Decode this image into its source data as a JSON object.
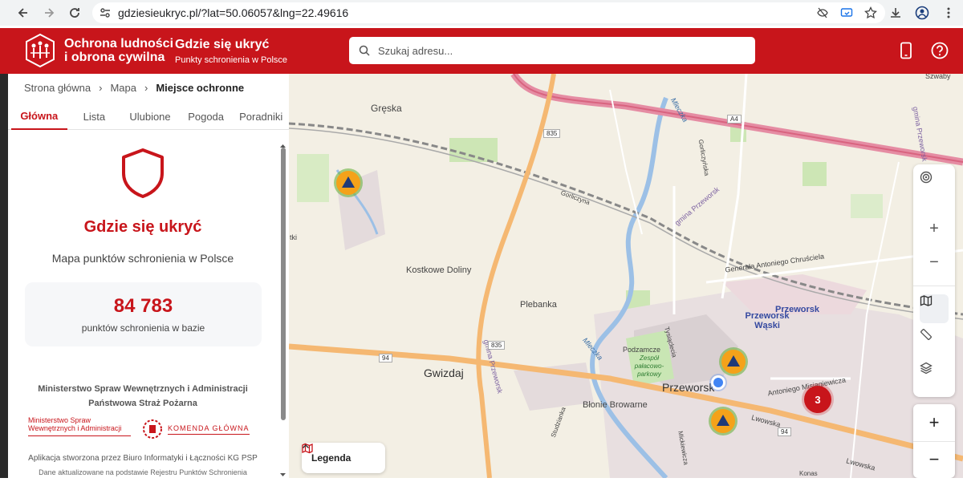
{
  "browser": {
    "url": "gdziesieukryc.pl/?lat=50.06057&lng=22.49616"
  },
  "header": {
    "brand_line1": "Ochrona ludności",
    "brand_line2": "i obrona cywilna",
    "app_title": "Gdzie się ukryć",
    "app_subtitle": "Punkty schronienia w Polsce",
    "search_placeholder": "Szukaj adresu...",
    "accent_color": "#c8151b"
  },
  "sidebar": {
    "breadcrumb": [
      "Strona główna",
      "Mapa",
      "Miejsce ochronne"
    ],
    "tabs": [
      {
        "label": "Główna",
        "active": true
      },
      {
        "label": "Lista",
        "active": false
      },
      {
        "label": "Ulubione",
        "active": false
      },
      {
        "label": "Pogoda",
        "active": false
      },
      {
        "label": "Poradniki",
        "active": false
      }
    ],
    "title": "Gdzie się ukryć",
    "subtitle": "Mapa punktów schronienia w Polsce",
    "stat_value": "84 783",
    "stat_label": "punktów schronienia w bazie",
    "ministry_line1": "Ministerstwo Spraw Wewnętrznych i Administracji",
    "ministry_line2": "Państwowa Straż Pożarna",
    "logo_mswia_line1": "Ministerstwo Spraw",
    "logo_mswia_line2": "Wewnętrznych i Administracji",
    "logo_kgp": "KOMENDA GŁÓWNA",
    "footer_line1": "Aplikacja stworzona przez Biuro Informatyki i Łączności KG PSP",
    "footer_line2": "Dane aktualizowane na podstawie Rejestru Punktów Schronienia"
  },
  "map": {
    "labels": {
      "grzeska": "Gręska",
      "kostkowe": "Kostkowe Doliny",
      "plebanka": "Plebanka",
      "gwizdaj": "Gwizdaj",
      "blonie": "Błonie Browarne",
      "przeworsk": "Przeworsk",
      "przeworsk_station": "Przeworsk",
      "przeworsk_waski": "Przeworsk Wąski",
      "podzamcze": "Podzamcze",
      "zespol": "Zespół pałacowo-parkowy",
      "szwaby": "Szwaby",
      "generala": "Generała Antoniego Chruściela",
      "misiagiewicza": "Antoniego Misiągiewicza",
      "lwowska": "Lwowska",
      "lwowska2": "Lwowska",
      "mleczka": "Mleczka",
      "mleczka2": "Mleczka",
      "goriczyna": "Gorliczyna",
      "gorliczynska": "Gorliczyńska",
      "tysiaclecia": "Tysiąclecia",
      "studzianka": "Studzianka",
      "gmina1": "gmina Przeworsk",
      "gmina2": "gmina Przeworsk",
      "gmina3": "gmina Przeworsk",
      "mickiewicza": "Mickiewicza",
      "konas": "Konas",
      "tki": "tki",
      "road_a4": "A4",
      "road_835a": "835",
      "road_835b": "835",
      "road_94a": "94",
      "road_94b": "94"
    },
    "cluster_count": "3",
    "legend_label": "Legenda",
    "zoom_in": "+",
    "zoom_out": "−",
    "ctrl_plus": "+",
    "ctrl_minus": "−"
  }
}
